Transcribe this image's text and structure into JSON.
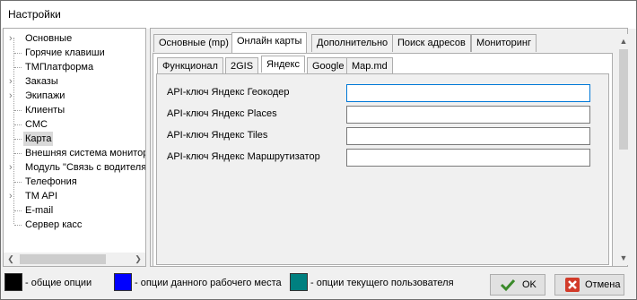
{
  "window": {
    "title": "Настройки"
  },
  "tree": {
    "items": [
      {
        "label": "Основные",
        "expandable": true
      },
      {
        "label": "Горячие клавиши",
        "expandable": false
      },
      {
        "label": "ТМПлатформа",
        "expandable": false
      },
      {
        "label": "Заказы",
        "expandable": true
      },
      {
        "label": "Экипажи",
        "expandable": true
      },
      {
        "label": "Клиенты",
        "expandable": false
      },
      {
        "label": "СМС",
        "expandable": false
      },
      {
        "label": "Карта",
        "expandable": false,
        "selected": true
      },
      {
        "label": "Внешняя система монитори",
        "expandable": false
      },
      {
        "label": "Модуль \"Связь с водителя",
        "expandable": true
      },
      {
        "label": "Телефония",
        "expandable": false
      },
      {
        "label": "TM API",
        "expandable": true
      },
      {
        "label": "E-mail",
        "expandable": false
      },
      {
        "label": "Сервер касс",
        "expandable": false
      }
    ]
  },
  "tabs_main": [
    "Основные (mp)",
    "Онлайн карты",
    "Дополнительно",
    "Поиск адресов",
    "Мониторинг"
  ],
  "tabs_main_active": 1,
  "tabs_sub": [
    "Функционал",
    "2GIS",
    "Яндекс",
    "Google",
    "Map.md"
  ],
  "tabs_sub_active": 2,
  "fields": [
    {
      "label": "API-ключ Яндекс Геокодер",
      "value": "",
      "focused": true
    },
    {
      "label": "API-ключ Яндекс Places",
      "value": ""
    },
    {
      "label": "API-ключ Яндекс Tiles",
      "value": ""
    },
    {
      "label": "API-ключ Яндекс Маршрутизатор",
      "value": ""
    }
  ],
  "legend": [
    {
      "label": "- общие опции",
      "color": "#000000"
    },
    {
      "label": "- опции данного рабочего места",
      "color": "#0000ff"
    },
    {
      "label": "- опции текущего пользователя",
      "color": "#008080"
    }
  ],
  "buttons": {
    "ok": "OK",
    "cancel": "Отмена"
  },
  "icons": {
    "ok": "checkmark-icon",
    "cancel": "close-icon",
    "expand": "chevron-right-icon"
  }
}
